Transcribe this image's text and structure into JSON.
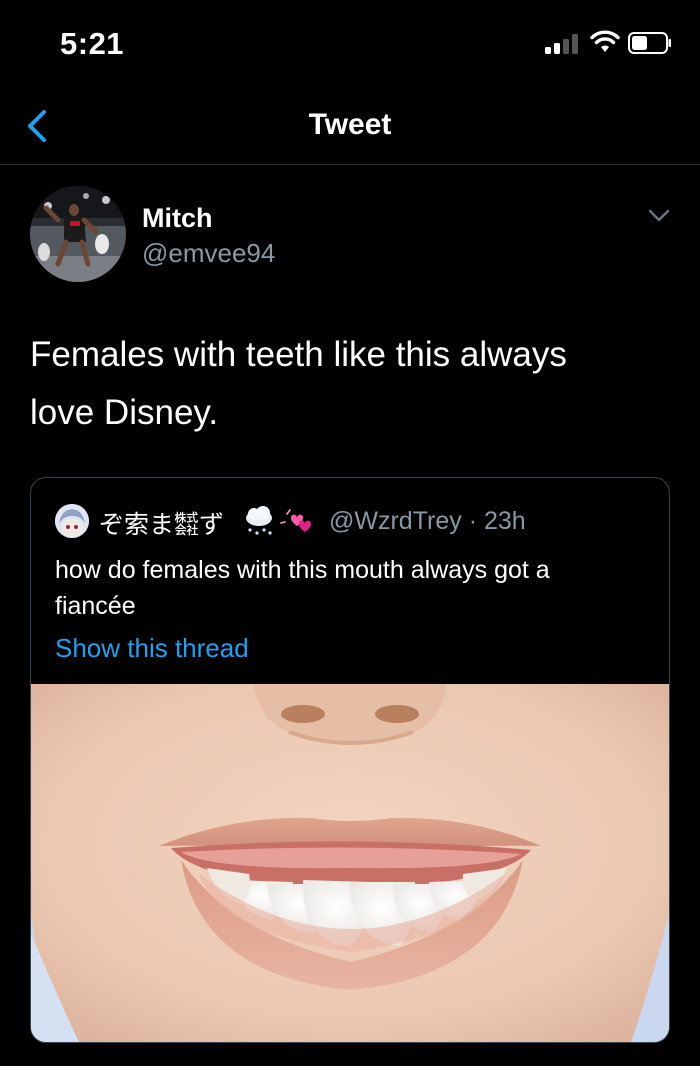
{
  "status_bar": {
    "time": "5:21",
    "signal_bars": 2,
    "battery_level": 0.45
  },
  "nav": {
    "title": "Tweet",
    "back_icon": "chevron-left-icon"
  },
  "tweet": {
    "author_name": "Mitch",
    "author_handle": "@emvee94",
    "text_line1": "Females with teeth like this always",
    "text_line2": "love Disney."
  },
  "quote": {
    "author_name": "ぞ索ま㍿ず",
    "author_handle_time": "@WzrdTrey · 23h",
    "text_line1": "how do females with this mouth always got a",
    "text_line2": "fiancée",
    "thread_link": "Show this thread"
  },
  "colors": {
    "background": "#000000",
    "accent": "#1da1f2",
    "secondary_text": "#8899a6",
    "border": "#38444d"
  }
}
